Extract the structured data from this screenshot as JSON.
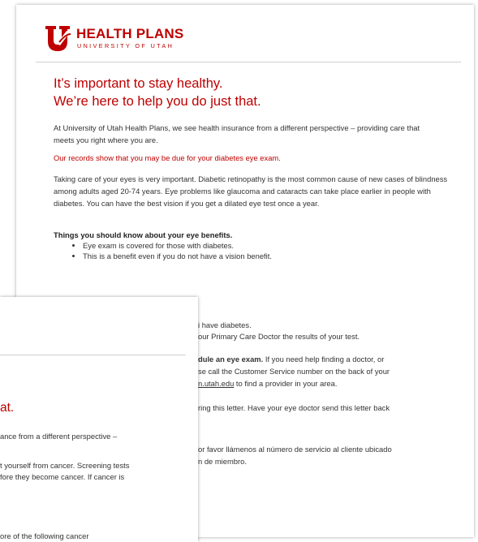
{
  "back_letter": {
    "logo_name": "HEALTH PLANS",
    "logo_sub": "UNIVERSITY OF UTAH",
    "headline_1": "It’s important to stay healthy.",
    "headline_2": "We’re here to help you do just that.",
    "intro": "At University of Utah Health Plans, we see health insurance from a different perspective – providing care that meets you right where you are.",
    "records": "Our records show that you may be due for your diabetes eye exam.",
    "eye_care": "Taking care of your eyes is very important.  Diabetic retinopathy is the most common cause of new cases of blindness among adults aged 20-74 years.  Eye problems like glaucoma and cataracts can take place earlier in people with diabetes. You can have the best vision if you get a dilated eye test once a year.",
    "benefits_heading": "Things you should know about your eye benefits.",
    "benefits": [
      "Eye exam is covered for those with diabetes.",
      "This is a benefit even if you do not have a vision benefit."
    ],
    "partial_lines": {
      "l1": "i have diabetes.",
      "l2": "our Primary Care Doctor the results of your test.",
      "l3a": "dule an eye exam.",
      "l3b": " If you need help finding a doctor, or",
      "l4": "se call the Customer Service number on the back of your",
      "l5_link": "n.utah.edu",
      "l5_rest": " to find a provider in your area.",
      "l6": "ring this letter. Have your eye doctor send this letter back",
      "l7": "or favor llámenos al número de servicio al cliente ubicado",
      "l8": "n de miembro."
    }
  },
  "front_letter": {
    "headline_fragment": "at.",
    "intro_fragment": "ance from a different perspective –",
    "cancer_1": "t yourself from cancer.  Screening tests",
    "cancer_2": "fore they become cancer. If cancer is",
    "records_fragment": "ore of the following cancer"
  },
  "colors": {
    "brand_red": "#be0000",
    "body_text": "#333333"
  }
}
